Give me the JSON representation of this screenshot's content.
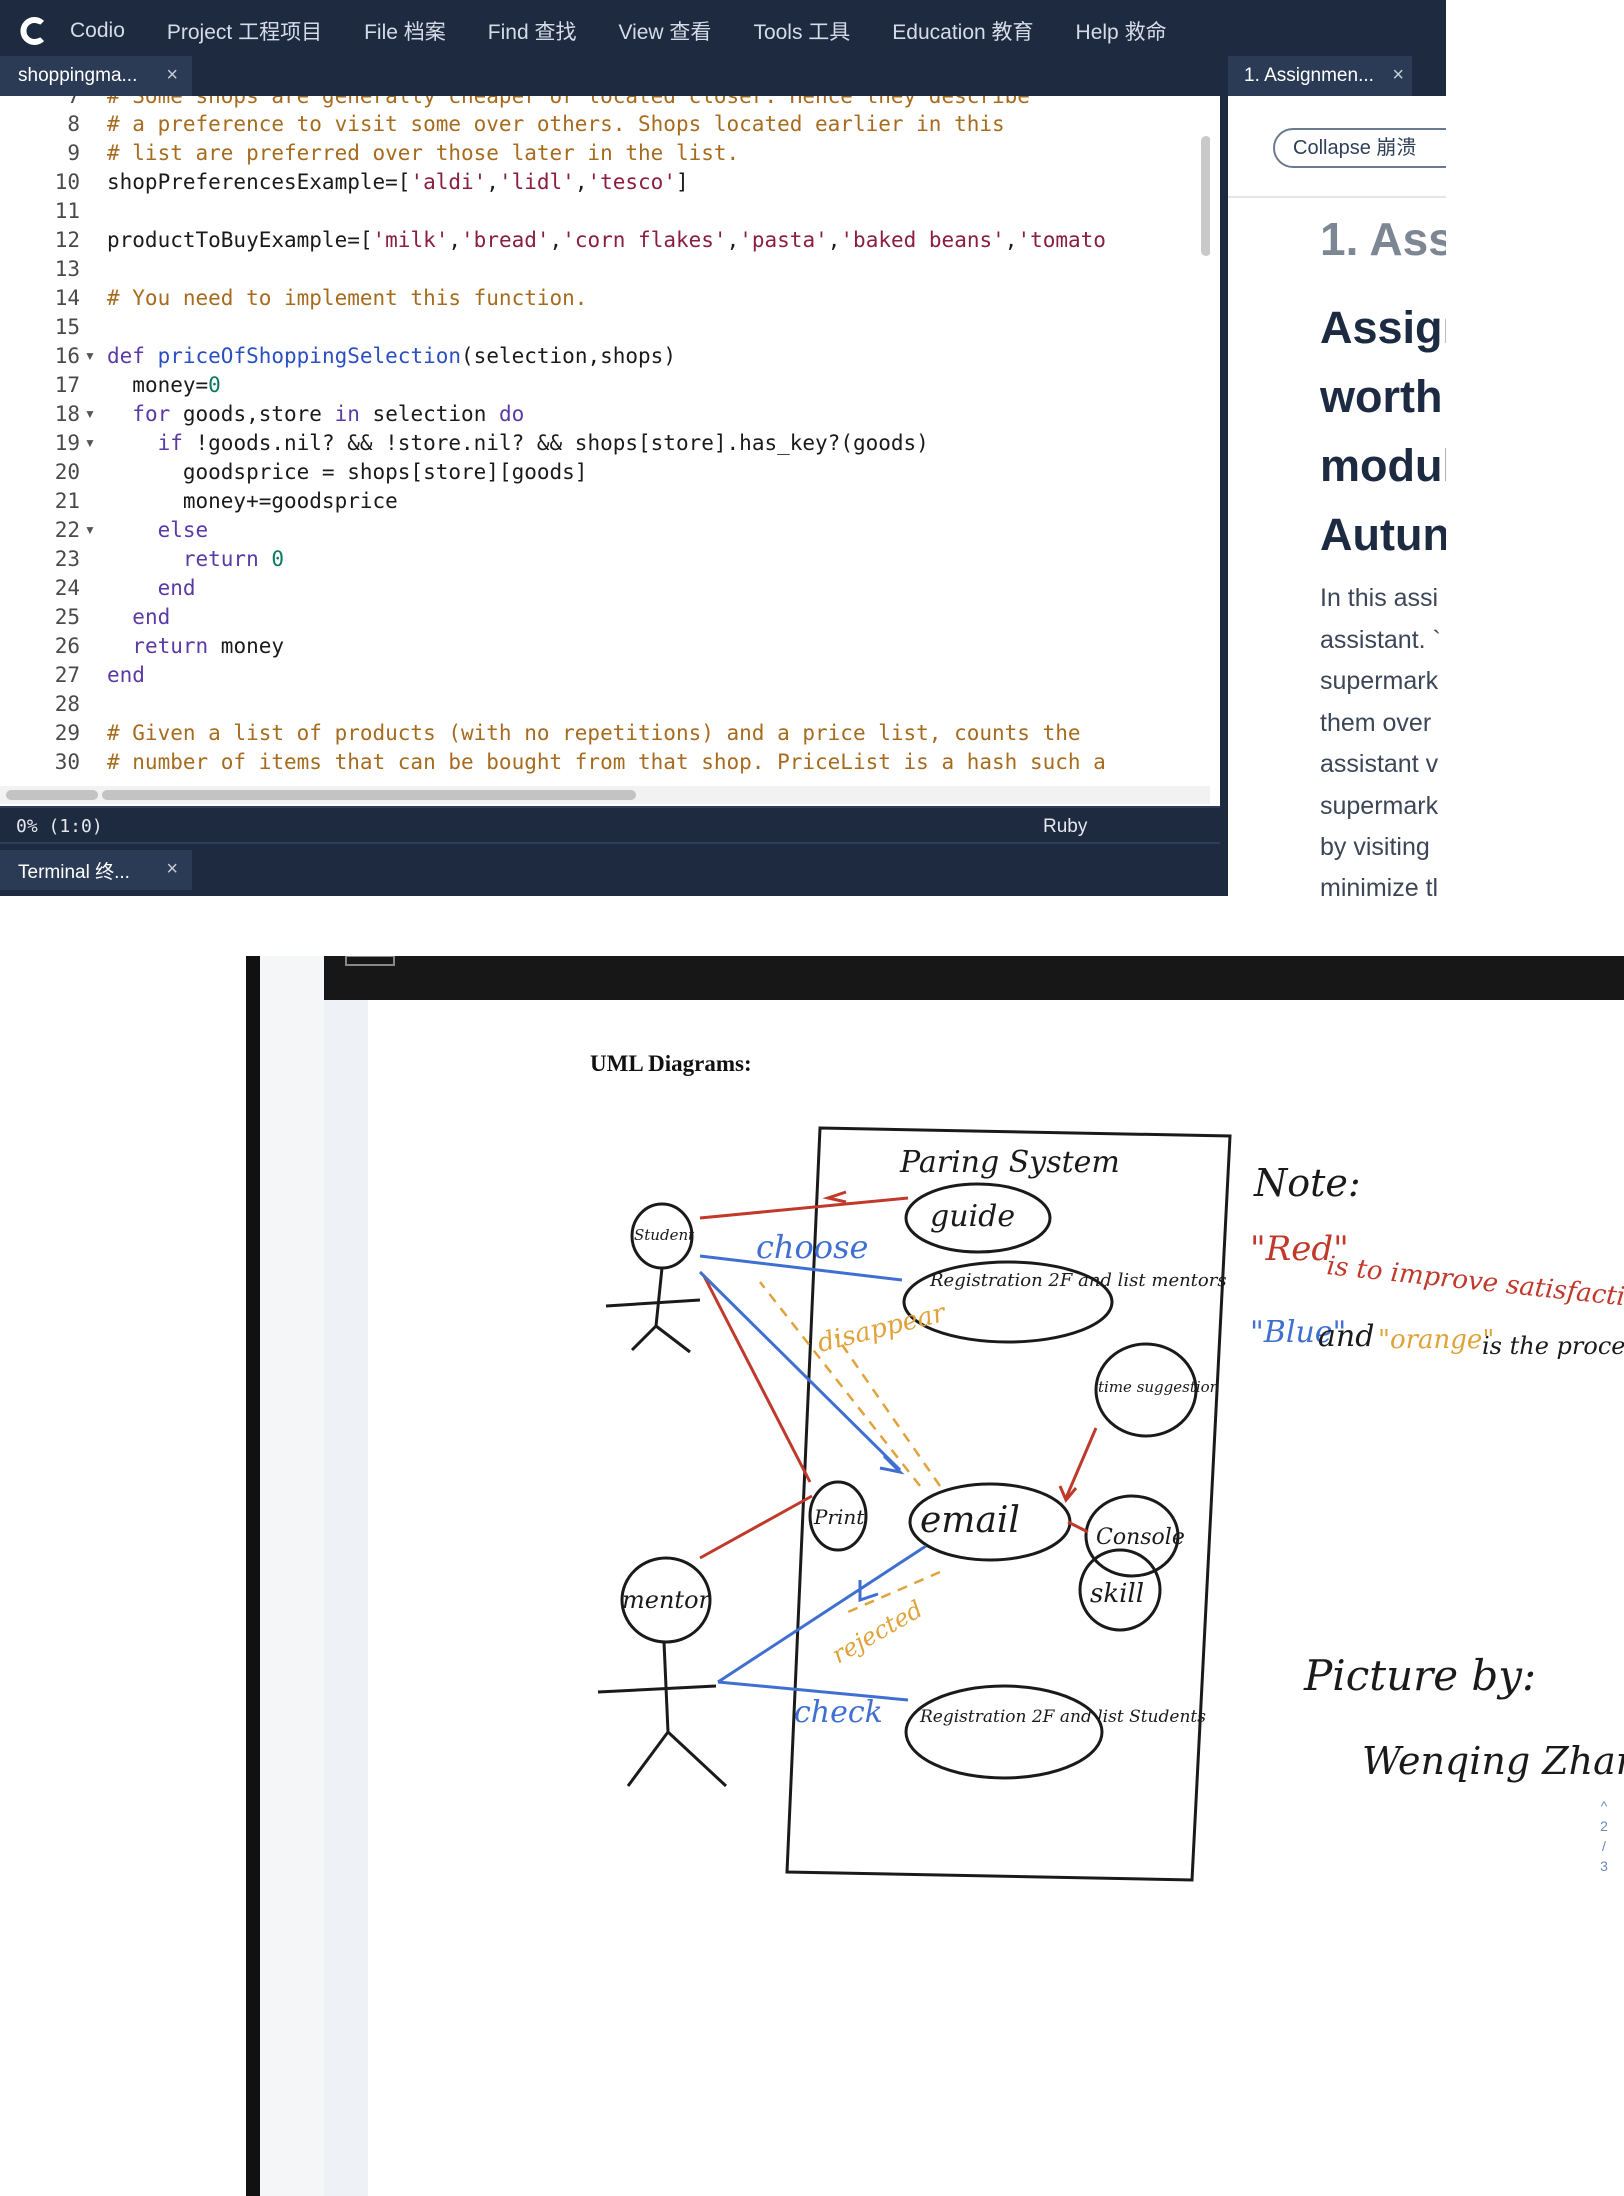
{
  "menu": {
    "items": [
      "Codio",
      "Project 工程项目",
      "File 档案",
      "Find 查找",
      "View 查看",
      "Tools 工具",
      "Education 教育",
      "Help 救命"
    ]
  },
  "tabs": {
    "editor_tab": "shoppingma...",
    "guide_tab": "1. Assignmen...",
    "terminal_tab": "Terminal 终..."
  },
  "editor": {
    "partial_top_line": "# Some shops are generally cheaper or located closer. Hence they describe",
    "line_numbers": [
      "8",
      "9",
      "10",
      "11",
      "12",
      "13",
      "14",
      "15",
      "16",
      "17",
      "18",
      "19",
      "20",
      "21",
      "22",
      "23",
      "24",
      "25",
      "26",
      "27",
      "28",
      "29",
      "30"
    ],
    "lines": {
      "l8": "# a preference to visit some over others. Shops located earlier in this",
      "l9": "# list are preferred over those later in the list.",
      "l10a": "shopPreferencesExample=[",
      "l10s1": "'aldi'",
      "l10s2": "'lidl'",
      "l10s3": "'tesco'",
      "l10b": "]",
      "l12a": "productToBuyExample=[",
      "l12s1": "'milk'",
      "l12s2": "'bread'",
      "l12s3": "'corn flakes'",
      "l12s4": "'pasta'",
      "l12s5": "'baked beans'",
      "l12s6": "'tomato",
      "l14": "# You need to implement this function.",
      "l16kw": "def",
      "l16fn": "priceOfShoppingSelection",
      "l16rest": "(selection,shops)",
      "l17a": "money=",
      "l17n": "0",
      "l18kw1": "for",
      "l18mid": " goods,store ",
      "l18kw2": "in",
      "l18mid2": " selection ",
      "l18kw3": "do",
      "l19kw": "if",
      "l19rest": " !goods.nil? && !store.nil? && shops[store].has_key?(goods)",
      "l20": "goodsprice = shops[store][goods]",
      "l21": "money+=goodsprice",
      "l22": "else",
      "l23kw": "return",
      "l23n": "0",
      "l24": "end",
      "l25": "end",
      "l26kw": "return",
      "l26rest": " money",
      "l27": "end",
      "l29": "# Given a list of products (with no repetitions) and a price list, counts the",
      "l30": "# number of items that can be bought from that shop. PriceList is a hash such a"
    },
    "comma": ","
  },
  "status": {
    "position": "0% (1:0)",
    "language": "Ruby"
  },
  "guide": {
    "collapse_label": "Collapse 崩溃",
    "title": "1. Ass",
    "heading_lines": [
      "Assigı",
      "worth",
      "modul",
      "Autun"
    ],
    "paragraph_lines": [
      "In this assi",
      "assistant. `",
      "supermark",
      "them over",
      "assistant v",
      "supermark",
      "by visiting",
      "minimize tl"
    ]
  },
  "document": {
    "title": "UML Diagrams:",
    "system_label": "Paring System",
    "actors": [
      "Student",
      "mentor"
    ],
    "use_cases": [
      "guide",
      "Registration 2F and list mentors",
      "time suggestion",
      "Print",
      "email",
      "Console",
      "skill",
      "Registration 2F and list Students"
    ],
    "edge_labels": [
      "choose",
      "disappear",
      "rejected",
      "check"
    ],
    "note_heading": "Note:",
    "note_red_word": "\"Red\"",
    "note_red_rest": "is to improve satisfaction",
    "note_blue_word": "\"Blue\"",
    "note_and": "and",
    "note_orange_word": "\"orange\"",
    "note_orange_rest": "is the process",
    "credit_line1": "Picture by:",
    "credit_line2": "Wenqing Zhang",
    "pager": [
      "^",
      "2",
      "/",
      "3"
    ]
  },
  "colors": {
    "menubar_bg": "#1d2a3f",
    "comment": "#a76b1e",
    "string": "#8b1e3f",
    "keyword": "#5a3aa6",
    "function": "#2a4fc0",
    "number": "#0b7a5b",
    "sketch_red": "#c0392b",
    "sketch_blue": "#3f6fd1",
    "sketch_orange": "#e0a23a"
  },
  "icons": [
    "codio-logo-icon",
    "close-icon",
    "fold-arrow-icon",
    "chevron-up-icon"
  ]
}
